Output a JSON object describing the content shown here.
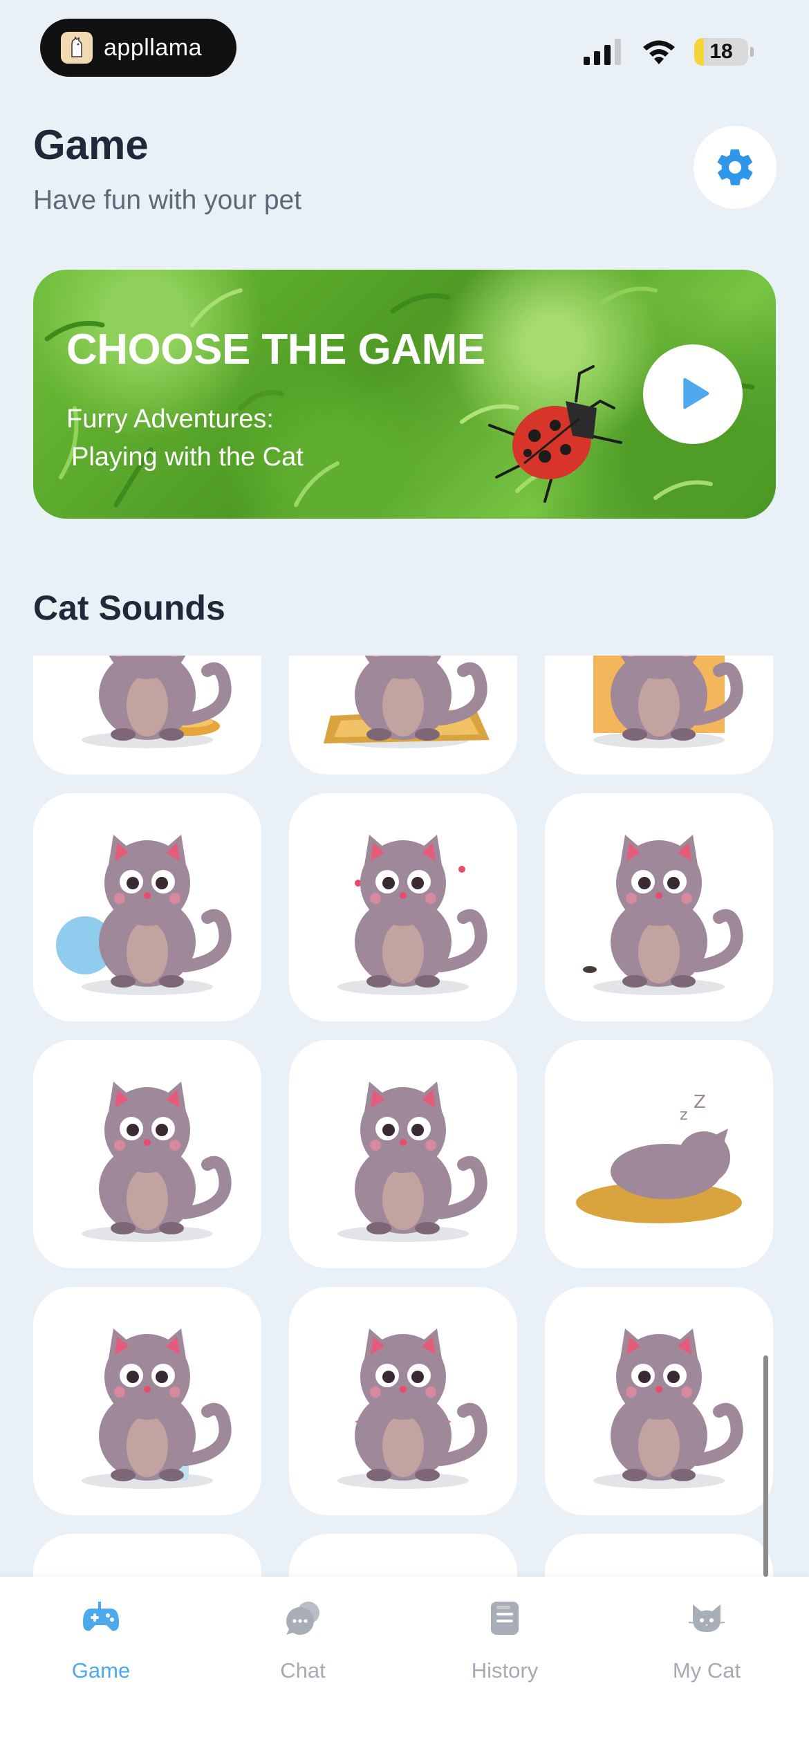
{
  "status_bar": {
    "brand": "appllama",
    "battery": "18",
    "battery_level": 0.18
  },
  "header": {
    "title": "Game",
    "subtitle": "Have fun with your pet"
  },
  "banner": {
    "title": "CHOOSE THE GAME",
    "subtitle_line1": "Furry Adventures:",
    "subtitle_line2": "Playing with the Cat"
  },
  "section": {
    "title": "Cat Sounds"
  },
  "tiles": [
    {
      "name": "cat-bowl"
    },
    {
      "name": "cat-pillow"
    },
    {
      "name": "cat-box"
    },
    {
      "name": "cat-fishbowl"
    },
    {
      "name": "cat-excited"
    },
    {
      "name": "cat-mouse"
    },
    {
      "name": "cat-crying"
    },
    {
      "name": "cat-sausage"
    },
    {
      "name": "cat-sleeping"
    },
    {
      "name": "cat-milk-spill"
    },
    {
      "name": "cat-bowtie"
    },
    {
      "name": "cat-yawning"
    }
  ],
  "tabs": [
    {
      "label": "Game",
      "icon": "gamepad-icon",
      "active": true
    },
    {
      "label": "Chat",
      "icon": "chat-icon",
      "active": false
    },
    {
      "label": "History",
      "icon": "history-icon",
      "active": false
    },
    {
      "label": "My Cat",
      "icon": "cat-icon",
      "active": false
    }
  ],
  "colors": {
    "accent": "#4da9ec",
    "background": "#e9f1f7",
    "cat_body": "#9f8899",
    "cat_belly": "#c3a3a0"
  }
}
